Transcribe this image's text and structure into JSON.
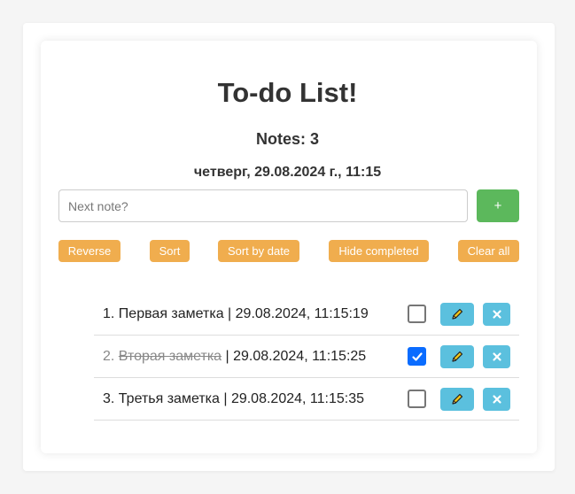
{
  "header": {
    "title": "To-do List!",
    "notes_count": "Notes: 3",
    "datetime": "четверг, 29.08.2024 г., 11:15"
  },
  "input": {
    "placeholder": "Next note?",
    "value": "",
    "add_label": "+"
  },
  "actions": {
    "reverse": "Reverse",
    "sort": "Sort",
    "sort_by_date": "Sort by date",
    "hide_completed": "Hide completed",
    "clear_all": "Clear all"
  },
  "notes": [
    {
      "index": "1.",
      "name": "Первая заметка",
      "suffix": " | 29.08.2024, 11:15:19",
      "completed": false
    },
    {
      "index": "2.",
      "name": "Вторая заметка",
      "suffix": " | 29.08.2024, 11:15:25",
      "completed": true
    },
    {
      "index": "3.",
      "name": "Третья заметка",
      "suffix": " | 29.08.2024, 11:15:35",
      "completed": false
    }
  ],
  "icons": {
    "edit": "pencil-icon",
    "delete": "close-icon",
    "check": "checkmark-icon"
  },
  "colors": {
    "add_button": "#5cb85c",
    "action_button": "#f0ad4e",
    "row_button": "#5bc0de",
    "checkbox_checked": "#0a6cff"
  }
}
